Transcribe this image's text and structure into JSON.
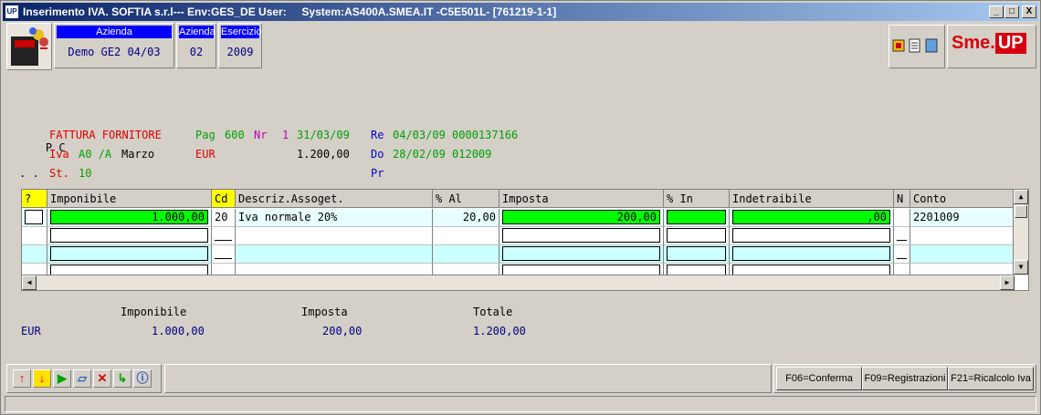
{
  "window": {
    "app_icon": "UP",
    "title": "Inserimento IVA.  SOFTIA s.r.l--- Env:GES_DE User:",
    "title_system": "System:AS400A.SMEA.IT -C5E501L- [761219-1-1]",
    "min_label": "_",
    "max_label": "□",
    "close_label": "X"
  },
  "header": {
    "azienda_label": "Azienda",
    "azienda_value": "Demo GE2 04/03",
    "azienda_code_label": "Azienda",
    "azienda_code_value": "02",
    "esercizio_label": "Esercizio",
    "esercizio_value": "2009",
    "logo_text": "Sme.",
    "logo_up": "UP"
  },
  "document": {
    "row1": {
      "pc": "P C",
      "type": "FATTURA FORNITORE",
      "pag_label": "Pag",
      "pag_value": "600",
      "nr_label": "Nr",
      "nr_value": "1",
      "date": "31/03/09",
      "re_label": "Re",
      "re_value": "04/03/09 0000137166"
    },
    "row2": {
      "iva_label": "Iva",
      "iva_value": "A0 /A",
      "month": "Marzo",
      "currency": "EUR",
      "amount": "1.200,00",
      "do_label": "Do",
      "do_value": "28/02/09 012009"
    },
    "row3": {
      "dots": ". .",
      "st_label": "St.",
      "st_value": "10",
      "pr_label": "Pr"
    }
  },
  "grid": {
    "columns": [
      "?",
      "Imponibile",
      "Cd",
      "Descriz.Assoget.",
      "% Al",
      "Imposta",
      "% In",
      "Indetraibile",
      "N",
      "Conto"
    ],
    "rows": [
      {
        "q": "",
        "imponibile": "1.000,00",
        "cd": "20",
        "descr": "Iva normale 20%",
        "al": "20,00",
        "imposta": "200,00",
        "in": "",
        "indetraibile": ",00",
        "n": "",
        "conto": "2201009"
      }
    ]
  },
  "totals": {
    "imponibile_label": "Imponibile",
    "imposta_label": "Imposta",
    "totale_label": "Totale",
    "currency": "EUR",
    "imponibile_value": "1.000,00",
    "imposta_value": "200,00",
    "totale_value": "1.200,00"
  },
  "toolbar": {
    "icons": [
      "arrow-up-red",
      "arrow-down-yellow",
      "play-green",
      "eraser",
      "delete-x-red",
      "refresh-green",
      "info"
    ]
  },
  "fkeys": {
    "f06": "F06=Conferma",
    "f09": "F09=Registrazioni",
    "f21": "F21=Ricalcolo Iva"
  }
}
